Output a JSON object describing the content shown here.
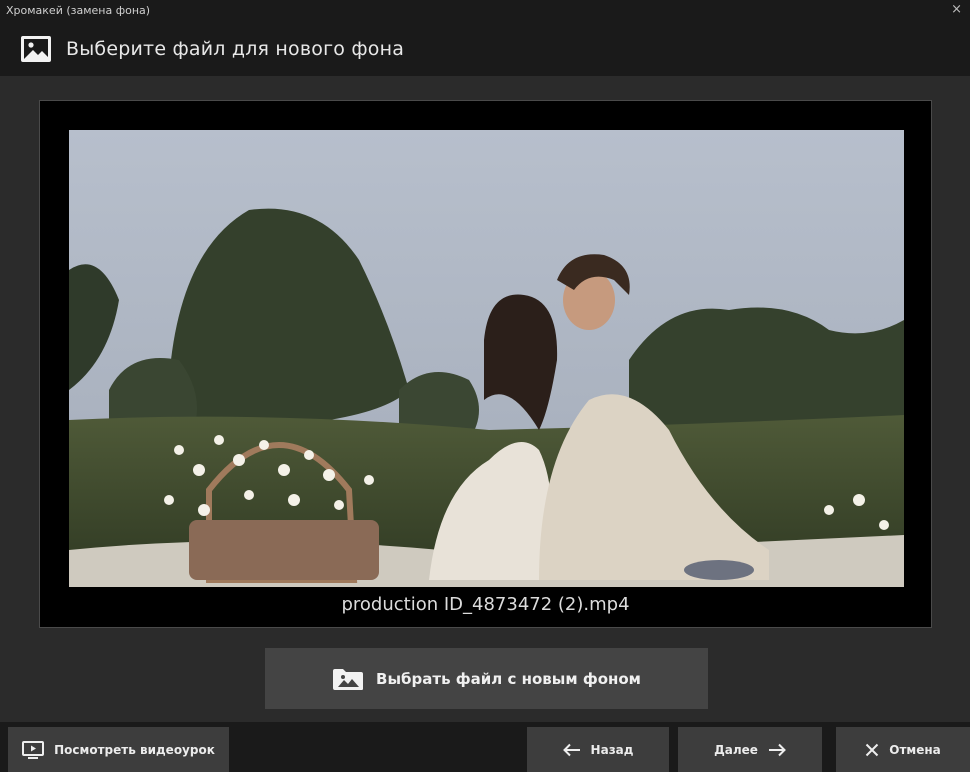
{
  "window": {
    "title": "Хромакей (замена фона)",
    "close_glyph": "×"
  },
  "header": {
    "icon": "image-icon",
    "title": "Выберите файл для нового фона"
  },
  "preview": {
    "filename": "production ID_4873472 (2).mp4"
  },
  "choose_button": {
    "icon": "folder-image-icon",
    "label": "Выбрать файл с новым фоном"
  },
  "footer": {
    "tutorial_label": "Посмотреть видеоурок",
    "back_label": "Назад",
    "next_label": "Далее",
    "cancel_label": "Отмена"
  },
  "colors": {
    "background": "#1c1c1c",
    "content": "#2b2b2b",
    "button": "#444444",
    "footer_button": "#3d3d3d"
  }
}
